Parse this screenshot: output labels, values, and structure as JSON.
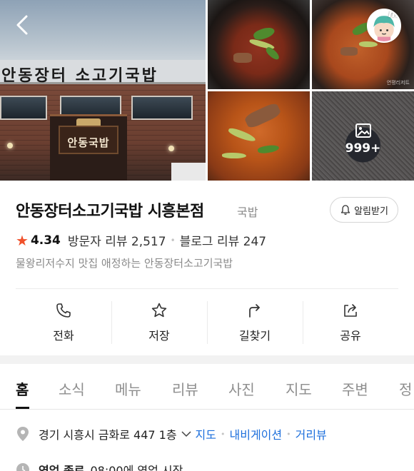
{
  "gallery": {
    "storefront_sign": "안동장터 소고기국밥",
    "store_sign_small": "안동국밥",
    "photo_more_count": "999+",
    "watermark": "연평리저트",
    "avatar_label": "my"
  },
  "place": {
    "name": "안동장터소고기국밥 시흥본점",
    "category": "국밥",
    "alarm_button": "알림받기",
    "rating": "4.34",
    "visitor_reviews": "방문자 리뷰 2,517",
    "blog_reviews": "블로그 리뷰 247",
    "description": "물왕리저수지 맛집 애정하는 안동장터소고기국밥"
  },
  "actions": [
    {
      "label": "전화",
      "icon": "phone-icon"
    },
    {
      "label": "저장",
      "icon": "star-outline-icon"
    },
    {
      "label": "길찾기",
      "icon": "directions-icon"
    },
    {
      "label": "공유",
      "icon": "share-icon"
    }
  ],
  "tabs": [
    "홈",
    "소식",
    "메뉴",
    "리뷰",
    "사진",
    "지도",
    "주변",
    "정"
  ],
  "active_tab": "홈",
  "address": {
    "text": "경기 시흥시 금화로 447 1층",
    "link_map": "지도",
    "link_navigation": "내비게이션",
    "link_street_view": "거리뷰"
  },
  "hours": {
    "status": "영업 종료",
    "text": "08:00에 영업 시작"
  },
  "colors": {
    "accent_star": "#f0512b",
    "link_blue": "#1d6fdc",
    "muted_text": "#8a8a8a"
  }
}
